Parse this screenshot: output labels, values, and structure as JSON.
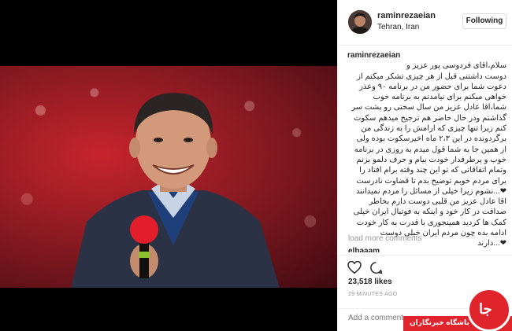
{
  "post": {
    "username": "raminrezaeian",
    "location": "Tehran, Iran",
    "follow_label": "Following",
    "caption_author": "raminrezaeian",
    "caption_lines": [
      "سلام،اقای فردوسی پور عزیز و",
      "دوست داشتنی قبل از هر چیزی تشکر میکنم از",
      "دعوت شما برای حضور من در برنامه ۹۰ وعذر",
      "خواهی میکنم برای نیامدنم به برنامه خوب",
      "شما،اقا عادل عزیز من سال سختی رو پشت سر",
      "گذاشتم ودر حال حاضر هم ترجیح میدهم سکوت",
      "کنم زیرا تنها چیزی که ارامش را به زندگی من",
      "برگردونده در این ۲،۳ ماه اخیرسکوت بوده ولی",
      "از همین جا به شما قول میدم به روزی در برنامه",
      "خوب و پرطرفدار خودت بیام و حرف دلمو بزنم",
      "وتمام اتفاقاتی که تو این چند وقته برام افتاد را",
      "برای مردم خوبم توضیح بدم تا قضاوت نادرست",
      "❤...نشوم زیرا خیلی از مسائل را مردم نمیدانند",
      "اقا عادل عزیز من قلبی دوست دارم بخاطر",
      "صداقت در کار خود و اینکه به فوتبال ایران خیلی",
      "کمک ها کردید همینجوری با قدرت به کار خودت",
      "ادامه بده چون مردم ایران خیلی دوست",
      "❤...دارند"
    ],
    "load_more": "load more comments",
    "next_comment_user": "elbaaam",
    "likes": "23,518 likes",
    "time_ago": "29 MINUTES AGO",
    "comment_placeholder": "Add a comment..."
  },
  "watermark": {
    "brand_text": "باشگاه خبرنگاران",
    "logo_text": "جا"
  },
  "colors": {
    "accent_red": "#e0242c",
    "text": "#262626",
    "muted": "#999999",
    "border": "#dbdbdb"
  },
  "icons": {
    "like": "heart-outline-icon",
    "comment": "speech-bubble-icon"
  }
}
